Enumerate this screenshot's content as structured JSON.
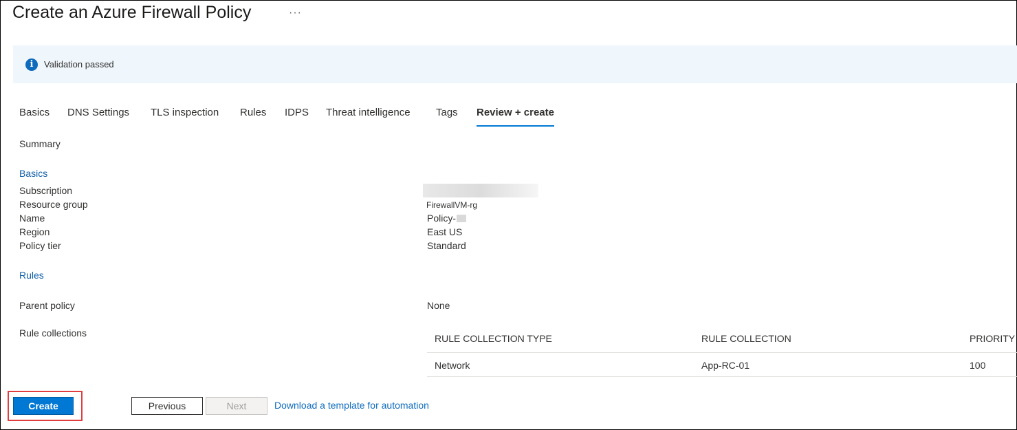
{
  "header": {
    "title": "Create an Azure Firewall Policy",
    "more_glyph": "···"
  },
  "banner": {
    "icon": "info-icon",
    "text": "Validation passed"
  },
  "tabs": [
    {
      "label": "Basics"
    },
    {
      "label": "DNS Settings"
    },
    {
      "label": "TLS inspection"
    },
    {
      "label": "Rules"
    },
    {
      "label": "IDPS"
    },
    {
      "label": "Threat intelligence"
    },
    {
      "label": "Tags"
    },
    {
      "label": "Review + create",
      "active": true
    }
  ],
  "summary": {
    "heading": "Summary",
    "basics": {
      "heading": "Basics",
      "subscription_label": "Subscription",
      "subscription_value": "",
      "resource_group_label": "Resource group",
      "resource_group_value": "FirewallVM-rg",
      "name_label": "Name",
      "name_value": "Policy-",
      "region_label": "Region",
      "region_value": "East US",
      "policy_tier_label": "Policy tier",
      "policy_tier_value": "Standard"
    },
    "rules": {
      "heading": "Rules",
      "parent_policy_label": "Parent policy",
      "parent_policy_value": "None",
      "rule_collections_label": "Rule collections",
      "table": {
        "columns": [
          "RULE COLLECTION TYPE",
          "RULE COLLECTION",
          "PRIORITY"
        ],
        "rows": [
          [
            "Network",
            "App-RC-01",
            "100"
          ]
        ]
      }
    }
  },
  "footer": {
    "create_label": "Create",
    "previous_label": "Previous",
    "next_label": "Next",
    "download_link": "Download a template for automation"
  },
  "colors": {
    "accent": "#0078d4",
    "link": "#0f6cbd",
    "banner_bg": "#eff6fc",
    "highlight": "#e03e3e"
  }
}
